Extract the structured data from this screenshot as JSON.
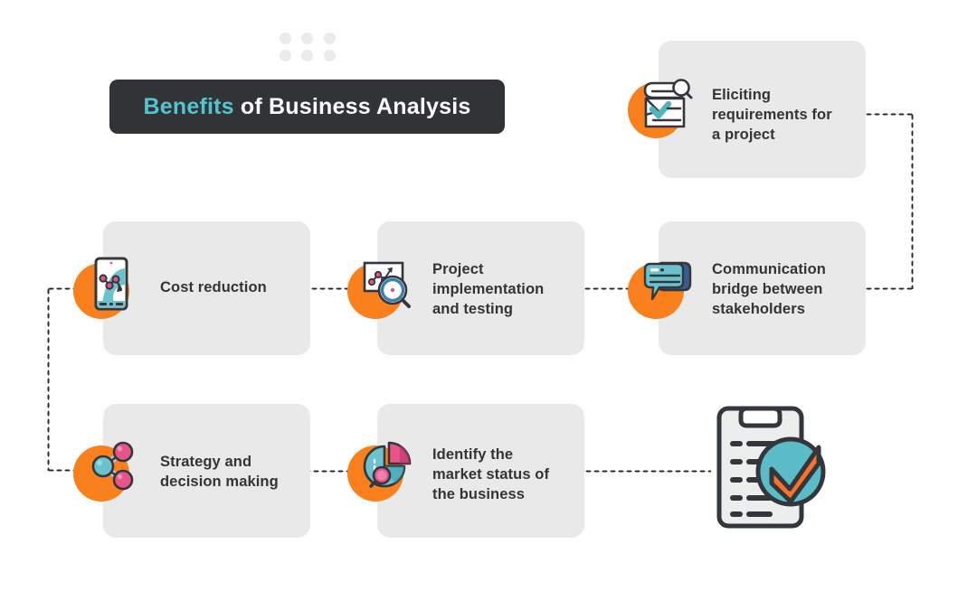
{
  "header": {
    "title_accent": "Benefits",
    "title_rest": " of Business Analysis",
    "decor_dots_count": 6
  },
  "colors": {
    "accent_orange": "#f9801d",
    "accent_teal": "#53c5d1",
    "title_bg": "#313337",
    "card_bg": "#e9e9e9",
    "text_dark": "#333437",
    "pink": "#e8548a",
    "navy": "#3a5b8c",
    "dot_grid": "#ebebeb",
    "connector": "#2b2b2b"
  },
  "cards": [
    {
      "id": "eliciting-requirements",
      "label": "Eliciting\nrequirements for\na project",
      "icon": "document-search-icon"
    },
    {
      "id": "cost-reduction",
      "label": "Cost reduction",
      "icon": "mobile-chart-icon"
    },
    {
      "id": "project-implementation",
      "label": "Project\nimplementation\nand testing",
      "icon": "chart-magnifier-icon"
    },
    {
      "id": "communication-bridge",
      "label": "Communication\nbridge between\nstakeholders",
      "icon": "speech-bubbles-icon"
    },
    {
      "id": "strategy-decision",
      "label": "Strategy and\ndecision making",
      "icon": "network-nodes-icon"
    },
    {
      "id": "identify-market",
      "label": "Identify the\nmarket status of\nthe business",
      "icon": "pie-chart-magnifier-icon"
    }
  ],
  "final_illustration": {
    "icon": "clipboard-check-icon"
  },
  "connectors": [
    {
      "id": "eliciting-to-communication",
      "style": "dotted"
    },
    {
      "id": "communication-to-project",
      "style": "dotted"
    },
    {
      "id": "project-to-cost",
      "style": "dotted"
    },
    {
      "id": "cost-to-strategy",
      "style": "dotted"
    },
    {
      "id": "strategy-to-identify",
      "style": "dotted"
    },
    {
      "id": "identify-to-clipboard",
      "style": "dotted"
    }
  ]
}
